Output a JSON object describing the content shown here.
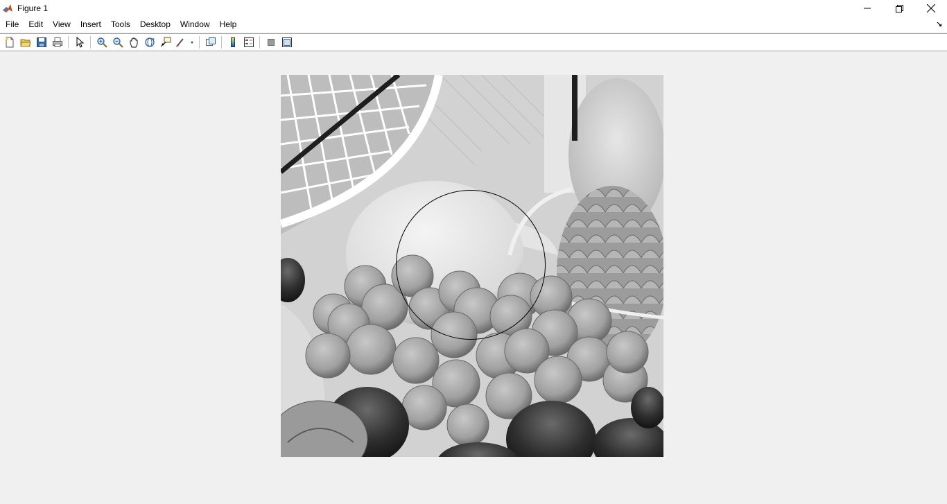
{
  "window": {
    "title": "Figure 1"
  },
  "menu": {
    "items": [
      "File",
      "Edit",
      "View",
      "Insert",
      "Tools",
      "Desktop",
      "Window",
      "Help"
    ]
  },
  "toolbar": {
    "buttons": [
      "new-figure-icon",
      "open-file-icon",
      "save-icon",
      "print-icon",
      "edit-plot-icon",
      "zoom-in-icon",
      "zoom-out-icon",
      "pan-icon",
      "rotate-3d-icon",
      "data-cursor-icon",
      "brush-icon",
      "link-plot-icon",
      "insert-colorbar-icon",
      "insert-legend-icon",
      "hide-plot-tools-icon",
      "show-plot-tools-icon"
    ]
  },
  "image": {
    "description_free": true,
    "overlay_shape": "circle",
    "colormap": "gray"
  }
}
